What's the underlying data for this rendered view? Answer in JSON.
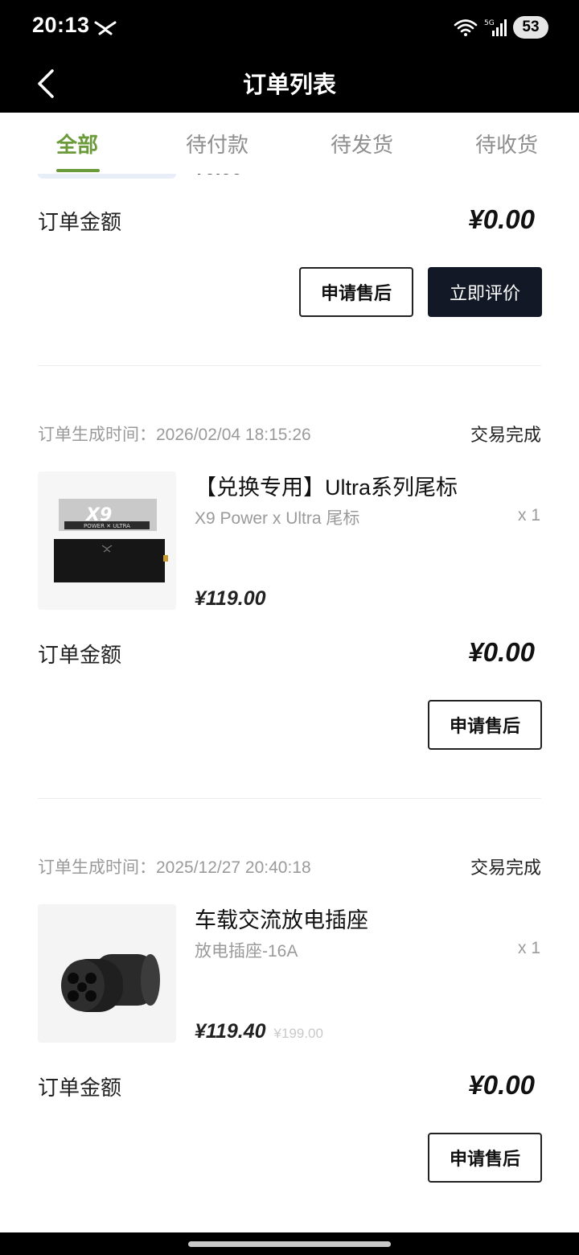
{
  "status_bar": {
    "time": "20:13",
    "battery": "53",
    "network": "5G"
  },
  "header": {
    "title": "订单列表"
  },
  "tabs": [
    {
      "label": "全部",
      "active": true
    },
    {
      "label": "待付款",
      "active": false
    },
    {
      "label": "待发货",
      "active": false
    },
    {
      "label": "待收货",
      "active": false
    }
  ],
  "partial_order": {
    "amount_label": "订单金额",
    "amount": "¥0.00",
    "buttons": {
      "after_sale": "申请售后",
      "review": "立即评价"
    }
  },
  "orders": [
    {
      "time_label": "订单生成时间：2026/02/04 18:15:26",
      "status": "交易完成",
      "product_name": "【兑换专用】Ultra系列尾标",
      "product_spec": "X9 Power x Ultra 尾标",
      "quantity": "x 1",
      "price": "¥119.00",
      "original_price": "",
      "thumb_text": "POWER ✕ ULTRA",
      "amount_label": "订单金额",
      "amount": "¥0.00",
      "button": "申请售后"
    },
    {
      "time_label": "订单生成时间：2025/12/27 20:40:18",
      "status": "交易完成",
      "product_name": "车载交流放电插座",
      "product_spec": "放电插座-16A",
      "quantity": "x 1",
      "price": "¥119.40",
      "original_price": "¥199.00",
      "amount_label": "订单金额",
      "amount": "¥0.00",
      "button": "申请售后"
    }
  ],
  "colors": {
    "accent": "#6a9a3a",
    "dark_button": "#121826",
    "header_bg": "#000000"
  }
}
